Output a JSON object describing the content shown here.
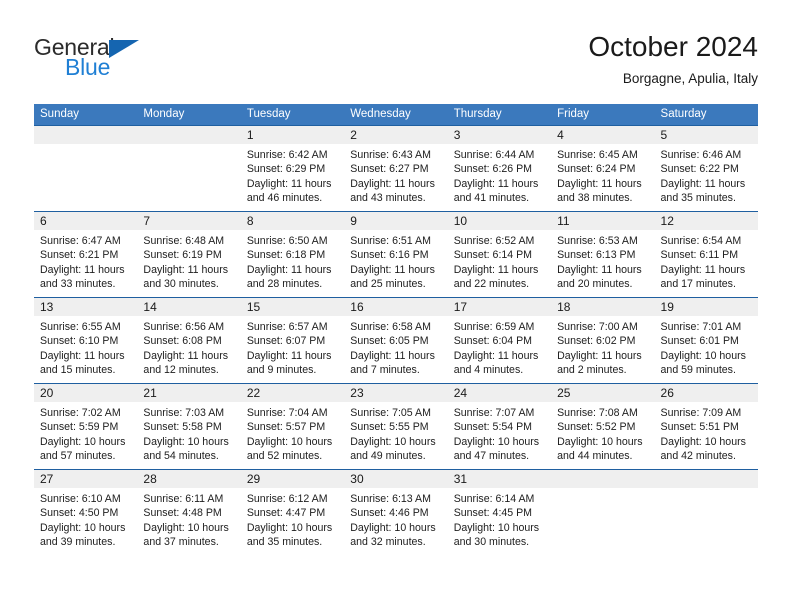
{
  "brand": {
    "name_top": "General",
    "name_bottom": "Blue",
    "triangle_color": "#1565b0",
    "blue_color": "#1f7fd4"
  },
  "header": {
    "title": "October 2024",
    "subtitle": "Borgagne, Apulia, Italy"
  },
  "theme": {
    "header_blue": "#3b79bd",
    "separator_blue": "#1f5fa0",
    "day_band_gray": "#efefef"
  },
  "weekdays": [
    "Sunday",
    "Monday",
    "Tuesday",
    "Wednesday",
    "Thursday",
    "Friday",
    "Saturday"
  ],
  "weeks": [
    [
      {
        "day": "",
        "empty": true,
        "sunrise": "",
        "sunset": "",
        "daylight_1": "",
        "daylight_2": ""
      },
      {
        "day": "",
        "empty": true,
        "sunrise": "",
        "sunset": "",
        "daylight_1": "",
        "daylight_2": ""
      },
      {
        "day": "1",
        "sunrise": "Sunrise: 6:42 AM",
        "sunset": "Sunset: 6:29 PM",
        "daylight_1": "Daylight: 11 hours",
        "daylight_2": "and 46 minutes."
      },
      {
        "day": "2",
        "sunrise": "Sunrise: 6:43 AM",
        "sunset": "Sunset: 6:27 PM",
        "daylight_1": "Daylight: 11 hours",
        "daylight_2": "and 43 minutes."
      },
      {
        "day": "3",
        "sunrise": "Sunrise: 6:44 AM",
        "sunset": "Sunset: 6:26 PM",
        "daylight_1": "Daylight: 11 hours",
        "daylight_2": "and 41 minutes."
      },
      {
        "day": "4",
        "sunrise": "Sunrise: 6:45 AM",
        "sunset": "Sunset: 6:24 PM",
        "daylight_1": "Daylight: 11 hours",
        "daylight_2": "and 38 minutes."
      },
      {
        "day": "5",
        "sunrise": "Sunrise: 6:46 AM",
        "sunset": "Sunset: 6:22 PM",
        "daylight_1": "Daylight: 11 hours",
        "daylight_2": "and 35 minutes."
      }
    ],
    [
      {
        "day": "6",
        "sunrise": "Sunrise: 6:47 AM",
        "sunset": "Sunset: 6:21 PM",
        "daylight_1": "Daylight: 11 hours",
        "daylight_2": "and 33 minutes."
      },
      {
        "day": "7",
        "sunrise": "Sunrise: 6:48 AM",
        "sunset": "Sunset: 6:19 PM",
        "daylight_1": "Daylight: 11 hours",
        "daylight_2": "and 30 minutes."
      },
      {
        "day": "8",
        "sunrise": "Sunrise: 6:50 AM",
        "sunset": "Sunset: 6:18 PM",
        "daylight_1": "Daylight: 11 hours",
        "daylight_2": "and 28 minutes."
      },
      {
        "day": "9",
        "sunrise": "Sunrise: 6:51 AM",
        "sunset": "Sunset: 6:16 PM",
        "daylight_1": "Daylight: 11 hours",
        "daylight_2": "and 25 minutes."
      },
      {
        "day": "10",
        "sunrise": "Sunrise: 6:52 AM",
        "sunset": "Sunset: 6:14 PM",
        "daylight_1": "Daylight: 11 hours",
        "daylight_2": "and 22 minutes."
      },
      {
        "day": "11",
        "sunrise": "Sunrise: 6:53 AM",
        "sunset": "Sunset: 6:13 PM",
        "daylight_1": "Daylight: 11 hours",
        "daylight_2": "and 20 minutes."
      },
      {
        "day": "12",
        "sunrise": "Sunrise: 6:54 AM",
        "sunset": "Sunset: 6:11 PM",
        "daylight_1": "Daylight: 11 hours",
        "daylight_2": "and 17 minutes."
      }
    ],
    [
      {
        "day": "13",
        "sunrise": "Sunrise: 6:55 AM",
        "sunset": "Sunset: 6:10 PM",
        "daylight_1": "Daylight: 11 hours",
        "daylight_2": "and 15 minutes."
      },
      {
        "day": "14",
        "sunrise": "Sunrise: 6:56 AM",
        "sunset": "Sunset: 6:08 PM",
        "daylight_1": "Daylight: 11 hours",
        "daylight_2": "and 12 minutes."
      },
      {
        "day": "15",
        "sunrise": "Sunrise: 6:57 AM",
        "sunset": "Sunset: 6:07 PM",
        "daylight_1": "Daylight: 11 hours",
        "daylight_2": "and 9 minutes."
      },
      {
        "day": "16",
        "sunrise": "Sunrise: 6:58 AM",
        "sunset": "Sunset: 6:05 PM",
        "daylight_1": "Daylight: 11 hours",
        "daylight_2": "and 7 minutes."
      },
      {
        "day": "17",
        "sunrise": "Sunrise: 6:59 AM",
        "sunset": "Sunset: 6:04 PM",
        "daylight_1": "Daylight: 11 hours",
        "daylight_2": "and 4 minutes."
      },
      {
        "day": "18",
        "sunrise": "Sunrise: 7:00 AM",
        "sunset": "Sunset: 6:02 PM",
        "daylight_1": "Daylight: 11 hours",
        "daylight_2": "and 2 minutes."
      },
      {
        "day": "19",
        "sunrise": "Sunrise: 7:01 AM",
        "sunset": "Sunset: 6:01 PM",
        "daylight_1": "Daylight: 10 hours",
        "daylight_2": "and 59 minutes."
      }
    ],
    [
      {
        "day": "20",
        "sunrise": "Sunrise: 7:02 AM",
        "sunset": "Sunset: 5:59 PM",
        "daylight_1": "Daylight: 10 hours",
        "daylight_2": "and 57 minutes."
      },
      {
        "day": "21",
        "sunrise": "Sunrise: 7:03 AM",
        "sunset": "Sunset: 5:58 PM",
        "daylight_1": "Daylight: 10 hours",
        "daylight_2": "and 54 minutes."
      },
      {
        "day": "22",
        "sunrise": "Sunrise: 7:04 AM",
        "sunset": "Sunset: 5:57 PM",
        "daylight_1": "Daylight: 10 hours",
        "daylight_2": "and 52 minutes."
      },
      {
        "day": "23",
        "sunrise": "Sunrise: 7:05 AM",
        "sunset": "Sunset: 5:55 PM",
        "daylight_1": "Daylight: 10 hours",
        "daylight_2": "and 49 minutes."
      },
      {
        "day": "24",
        "sunrise": "Sunrise: 7:07 AM",
        "sunset": "Sunset: 5:54 PM",
        "daylight_1": "Daylight: 10 hours",
        "daylight_2": "and 47 minutes."
      },
      {
        "day": "25",
        "sunrise": "Sunrise: 7:08 AM",
        "sunset": "Sunset: 5:52 PM",
        "daylight_1": "Daylight: 10 hours",
        "daylight_2": "and 44 minutes."
      },
      {
        "day": "26",
        "sunrise": "Sunrise: 7:09 AM",
        "sunset": "Sunset: 5:51 PM",
        "daylight_1": "Daylight: 10 hours",
        "daylight_2": "and 42 minutes."
      }
    ],
    [
      {
        "day": "27",
        "sunrise": "Sunrise: 6:10 AM",
        "sunset": "Sunset: 4:50 PM",
        "daylight_1": "Daylight: 10 hours",
        "daylight_2": "and 39 minutes."
      },
      {
        "day": "28",
        "sunrise": "Sunrise: 6:11 AM",
        "sunset": "Sunset: 4:48 PM",
        "daylight_1": "Daylight: 10 hours",
        "daylight_2": "and 37 minutes."
      },
      {
        "day": "29",
        "sunrise": "Sunrise: 6:12 AM",
        "sunset": "Sunset: 4:47 PM",
        "daylight_1": "Daylight: 10 hours",
        "daylight_2": "and 35 minutes."
      },
      {
        "day": "30",
        "sunrise": "Sunrise: 6:13 AM",
        "sunset": "Sunset: 4:46 PM",
        "daylight_1": "Daylight: 10 hours",
        "daylight_2": "and 32 minutes."
      },
      {
        "day": "31",
        "sunrise": "Sunrise: 6:14 AM",
        "sunset": "Sunset: 4:45 PM",
        "daylight_1": "Daylight: 10 hours",
        "daylight_2": "and 30 minutes."
      },
      {
        "day": "",
        "empty": true,
        "sunrise": "",
        "sunset": "",
        "daylight_1": "",
        "daylight_2": ""
      },
      {
        "day": "",
        "empty": true,
        "sunrise": "",
        "sunset": "",
        "daylight_1": "",
        "daylight_2": ""
      }
    ]
  ]
}
